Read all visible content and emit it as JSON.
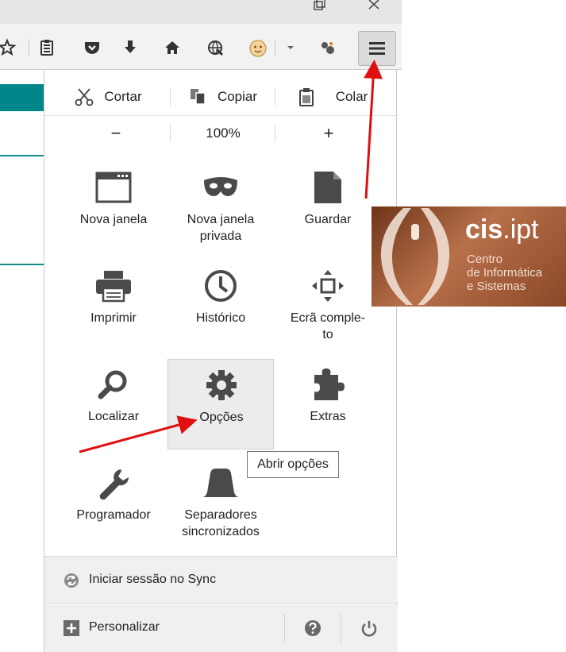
{
  "edit": {
    "cut": "Cortar",
    "copy": "Copiar",
    "paste": "Colar"
  },
  "zoom": {
    "minus": "−",
    "level": "100%",
    "plus": "+"
  },
  "items": [
    {
      "label": "Nova janela",
      "icon": "window-icon"
    },
    {
      "label": "Nova janela\nprivada",
      "icon": "mask-icon"
    },
    {
      "label": "Guardar",
      "icon": "page-icon"
    },
    {
      "label": "Imprimir",
      "icon": "printer-icon"
    },
    {
      "label": "Histórico",
      "icon": "clock-icon"
    },
    {
      "label": "Ecrã comple-\nto",
      "icon": "fullscreen-icon"
    },
    {
      "label": "Localizar",
      "icon": "search-icon"
    },
    {
      "label": "Opções",
      "icon": "gear-icon"
    },
    {
      "label": "Extras",
      "icon": "puzzle-icon"
    },
    {
      "label": "Programador",
      "icon": "wrench-icon"
    },
    {
      "label": "Separadores\nsincronizados",
      "icon": "tabs-sync-icon"
    }
  ],
  "tooltip": "Abrir opções",
  "footer": {
    "sync": "Iniciar sessão no Sync",
    "customize": "Personalizar"
  },
  "logo": {
    "brand_bold": "cis",
    "brand_light": ".ipt",
    "line1": "Centro",
    "line2": "de Informática",
    "line3": "e Sistemas"
  },
  "colors": {
    "accent_teal": "#00868b",
    "arrow_red": "#e01010"
  }
}
